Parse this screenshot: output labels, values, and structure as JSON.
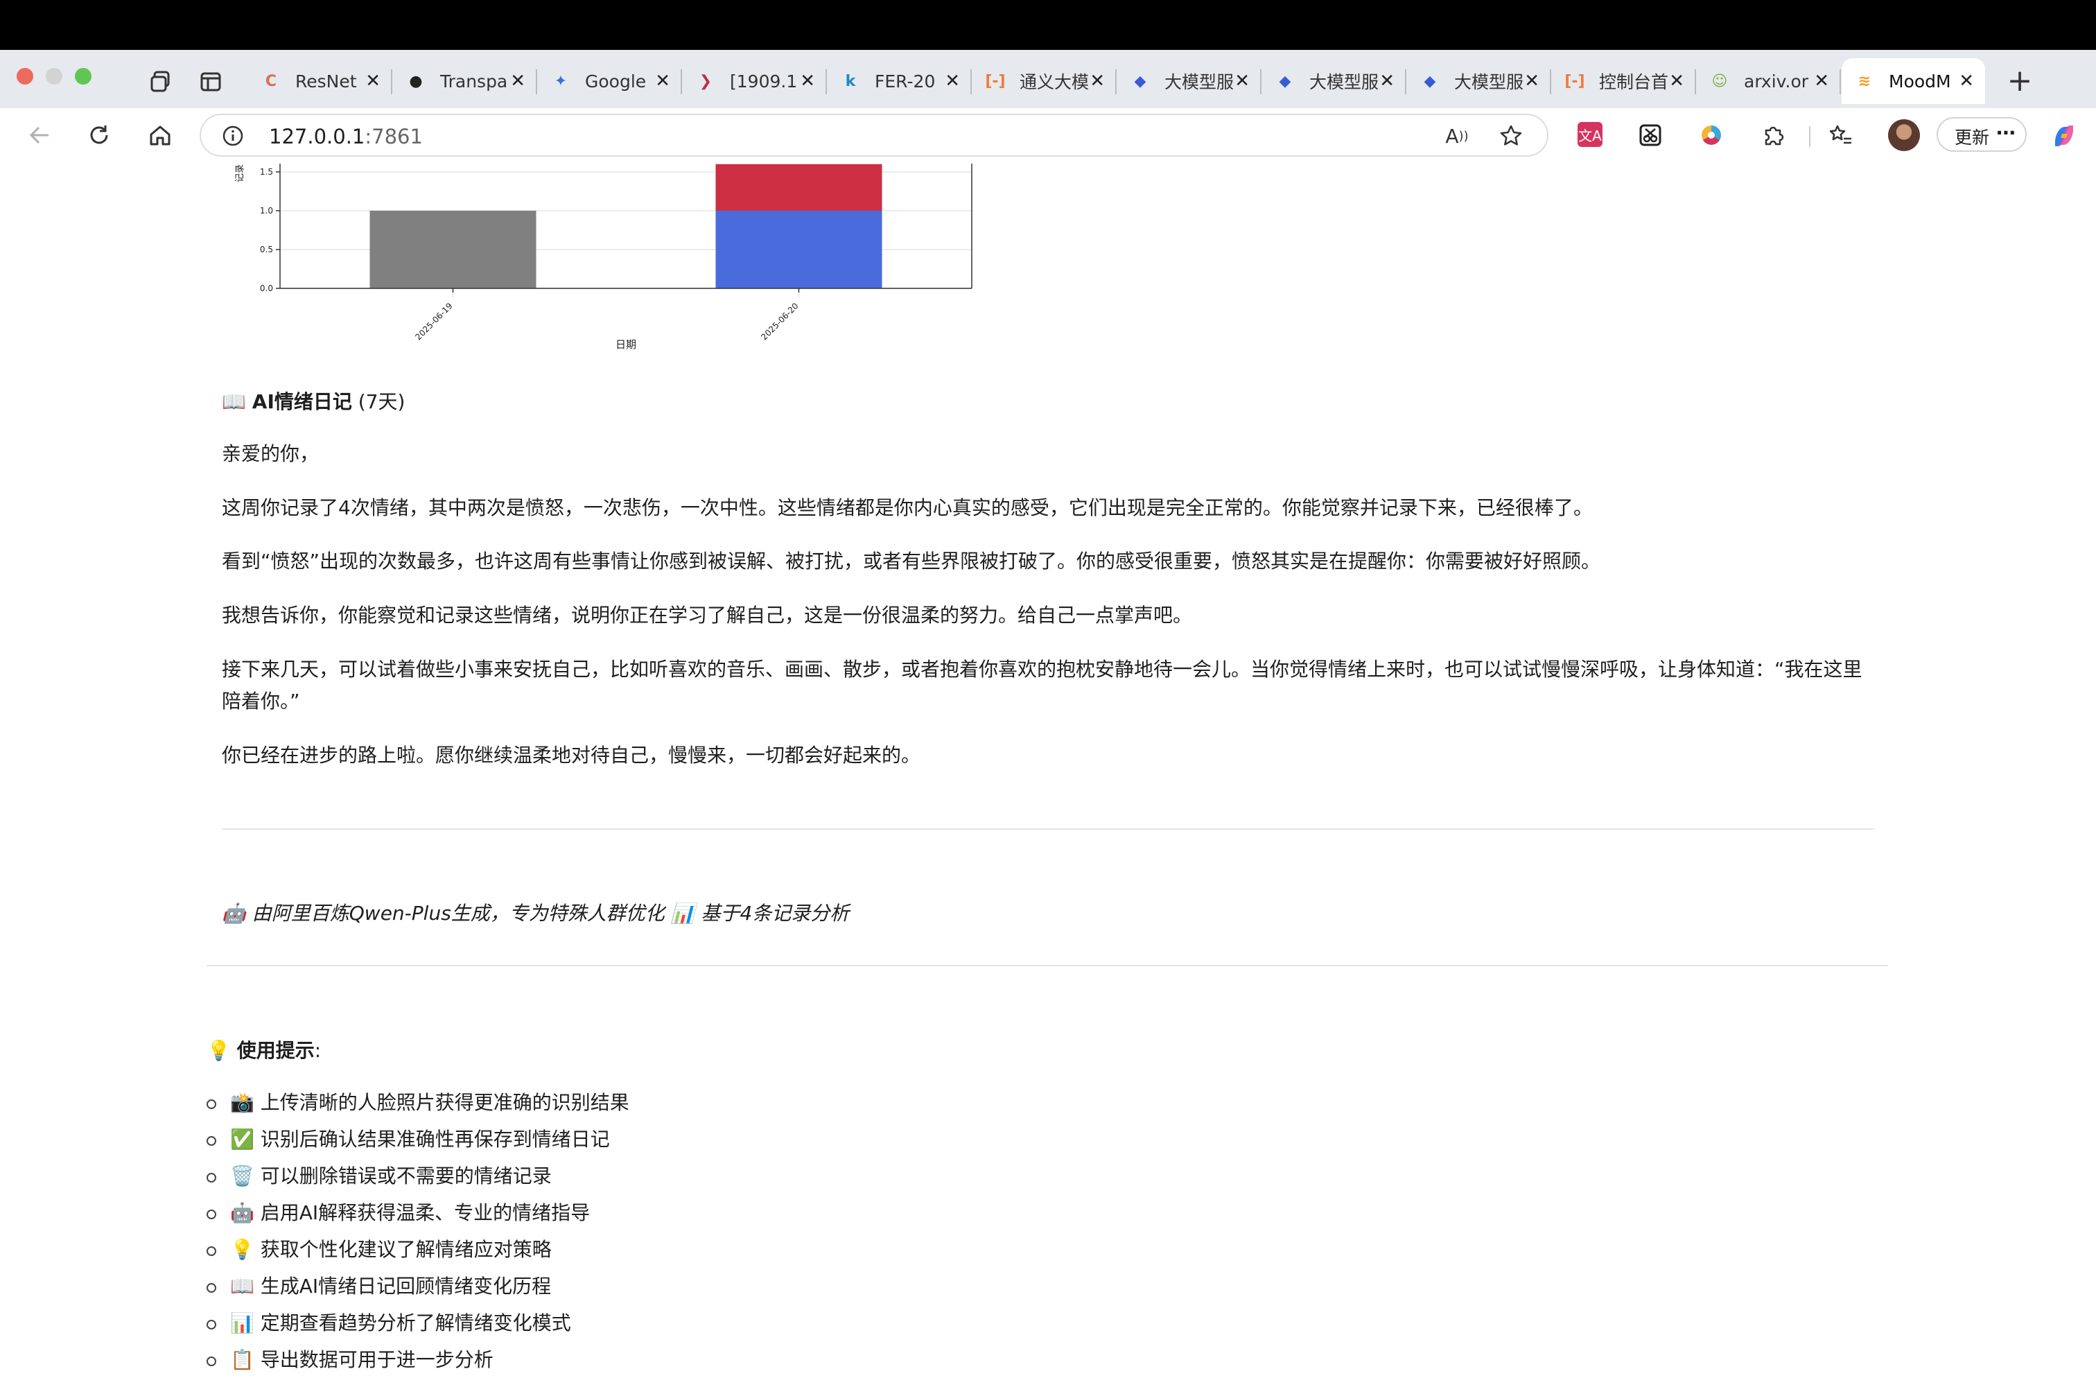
{
  "browser": {
    "tabs": [
      {
        "title": "ResNet",
        "favicon_char": "C",
        "favicon_color": "#d9705a"
      },
      {
        "title": "Transpa",
        "favicon_char": "●",
        "favicon_color": "#222222"
      },
      {
        "title": "Google",
        "favicon_char": "✦",
        "favicon_color": "#3b6fe0"
      },
      {
        "title": "[1909.1",
        "favicon_char": "❯",
        "favicon_color": "#b8324a"
      },
      {
        "title": "FER-20",
        "favicon_char": "k",
        "favicon_color": "#1f8ac0"
      },
      {
        "title": "通义大模",
        "favicon_char": "[-]",
        "favicon_color": "#f07a3c"
      },
      {
        "title": "大模型服",
        "favicon_char": "◆",
        "favicon_color": "#3a5bd6"
      },
      {
        "title": "大模型服",
        "favicon_char": "◆",
        "favicon_color": "#3a5bd6"
      },
      {
        "title": "大模型服",
        "favicon_char": "◆",
        "favicon_color": "#3a5bd6"
      },
      {
        "title": "控制台首",
        "favicon_char": "[-]",
        "favicon_color": "#f07a3c"
      },
      {
        "title": "arxiv.or",
        "favicon_char": "☺",
        "favicon_color": "#7cb342"
      },
      {
        "title": "MoodM",
        "favicon_char": "≋",
        "favicon_color": "#f0a020",
        "active": true
      }
    ],
    "url_host": "127.0.0.1",
    "url_port": ":7861",
    "update_label": "更新",
    "menu_label": "⋯"
  },
  "chart_data": {
    "type": "bar",
    "stacked": true,
    "categories": [
      "2025-06-19",
      "2025-06-20"
    ],
    "series": [
      {
        "name": "",
        "color": "#808080",
        "values": [
          1,
          0
        ]
      },
      {
        "name": "",
        "color": "#4a6bdc",
        "values": [
          0,
          1
        ]
      },
      {
        "name": "",
        "color": "#cc2f42",
        "values": [
          0,
          0.6
        ]
      }
    ],
    "yticks": [
      "0.0",
      "0.5",
      "1.0",
      "1.5"
    ],
    "ylabel": "记录",
    "xlabel": "日期",
    "grid": true
  },
  "diary": {
    "icon": "📖",
    "title": "AI情绪日记",
    "subtitle": "(7天)",
    "greeting": "亲爱的你，",
    "paragraphs": [
      "这周你记录了4次情绪，其中两次是愤怒，一次悲伤，一次中性。这些情绪都是你内心真实的感受，它们出现是完全正常的。你能觉察并记录下来，已经很棒了。",
      "看到“愤怒”出现的次数最多，也许这周有些事情让你感到被误解、被打扰，或者有些界限被打破了。你的感受很重要，愤怒其实是在提醒你：你需要被好好照顾。",
      "我想告诉你，你能察觉和记录这些情绪，说明你正在学习了解自己，这是一份很温柔的努力。给自己一点掌声吧。",
      "接下来几天，可以试着做些小事来安抚自己，比如听喜欢的音乐、画画、散步，或者抱着你喜欢的抱枕安静地待一会儿。当你觉得情绪上来时，也可以试试慢慢深呼吸，让身体知道：“我在这里陪着你。”",
      "你已经在进步的路上啦。愿你继续温柔地对待自己，慢慢来，一切都会好起来的。"
    ],
    "footer": "🤖 由阿里百炼Qwen-Plus生成，专为特殊人群优化 📊 基于4条记录分析"
  },
  "tips": {
    "icon": "💡",
    "title": "使用提示",
    "colon": ":",
    "items": [
      "📸 上传清晰的人脸照片获得更准确的识别结果",
      "✅ 识别后确认结果准确性再保存到情绪日记",
      "🗑️ 可以删除错误或不需要的情绪记录",
      "🤖 启用AI解释获得温柔、专业的情绪指导",
      "💡 获取个性化建议了解情绪应对策略",
      "📖 生成AI情绪日记回顾情绪变化历程",
      "📊 定期查看趋势分析了解情绪变化模式",
      "📋 导出数据可用于进一步分析"
    ]
  }
}
